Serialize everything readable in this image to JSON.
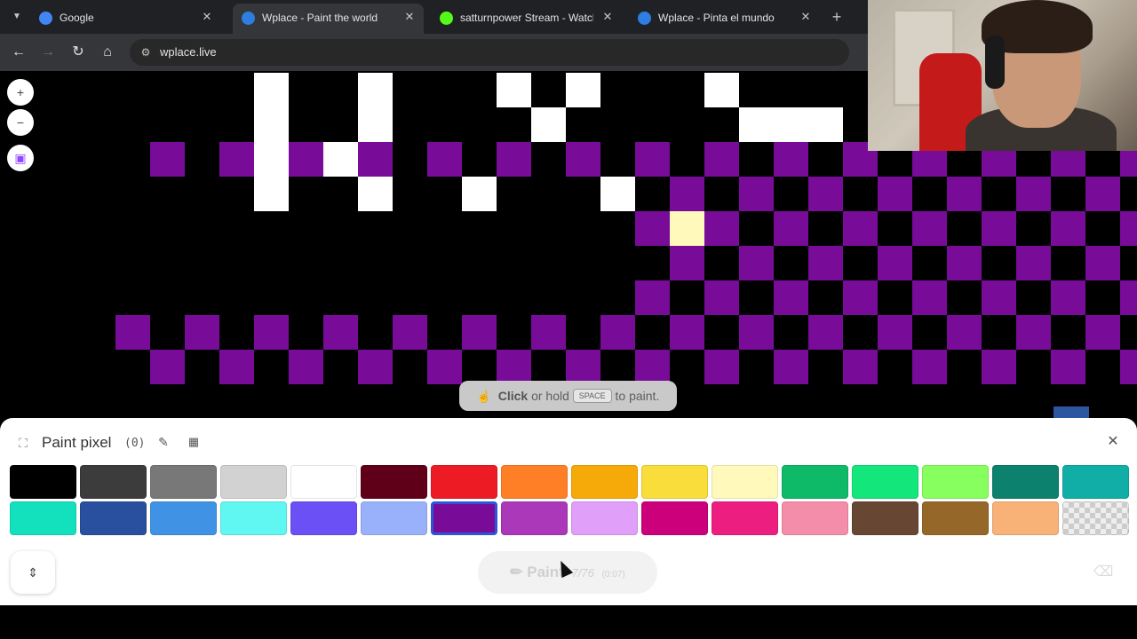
{
  "browser": {
    "tabs": [
      {
        "title": "Google",
        "favicon_color": "#4285f4",
        "active": false
      },
      {
        "title": "Wplace - Paint the world",
        "favicon_color": "#2e7de0",
        "active": true
      },
      {
        "title": "satturnpower Stream - Watch L",
        "favicon_color": "#53fc18",
        "active": false
      },
      {
        "title": "Wplace - Pinta el mundo",
        "favicon_color": "#2e7de0",
        "active": false
      }
    ],
    "url": "wplace.live"
  },
  "hint": {
    "click": "Click",
    "or_hold": "or hold",
    "key": "SPACE",
    "to_paint": "to paint."
  },
  "panel": {
    "title": "Paint pixel",
    "count": "(0)",
    "paint_label": "Paint",
    "paint_count": "7/76",
    "paint_timer": "(0:07)",
    "palette_row1": [
      "#000000",
      "#3c3c3c",
      "#787878",
      "#d2d2d2",
      "#ffffff",
      "#600018",
      "#ed1c24",
      "#ff7f27",
      "#f6aa09",
      "#f9dd3b",
      "#fffabc",
      "#0eb968",
      "#13e67b",
      "#87ff5e",
      "#0c816e",
      "#10aea6"
    ],
    "palette_row2": [
      "#13e1be",
      "#28509e",
      "#4093e4",
      "#60f7f2",
      "#6b50f6",
      "#99b1fb",
      "#780c99",
      "#aa38b9",
      "#e09ff9",
      "#cb007a",
      "#ec1f80",
      "#f38da9",
      "#684634",
      "#95682a",
      "#f8b277",
      "transparent"
    ],
    "selected_color": "#780c99"
  },
  "canvas": {
    "purple": "#780c99",
    "highlight": "#fffabc",
    "white": "#ffffff"
  }
}
